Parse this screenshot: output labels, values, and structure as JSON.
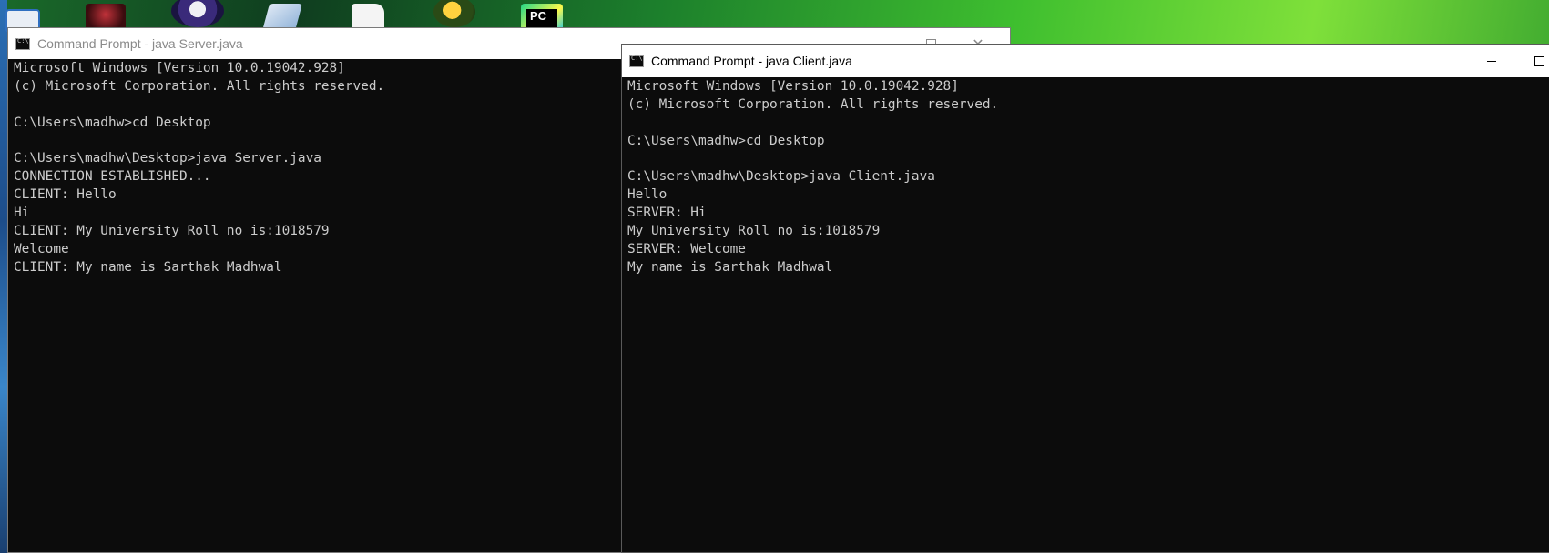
{
  "desktop": {
    "icons": [
      "windows-explorer-icon",
      "game-icon",
      "eclipse-icon",
      "notepad-icon",
      "file-icon",
      "app-icon",
      "pycharm-icon"
    ],
    "pycharm_label": "PC"
  },
  "server_window": {
    "title": "Command Prompt - java  Server.java",
    "lines": [
      "Microsoft Windows [Version 10.0.19042.928]",
      "(c) Microsoft Corporation. All rights reserved.",
      "",
      "C:\\Users\\madhw>cd Desktop",
      "",
      "C:\\Users\\madhw\\Desktop>java Server.java",
      "CONNECTION ESTABLISHED...",
      "CLIENT: Hello",
      "Hi",
      "CLIENT: My University Roll no is:1018579",
      "Welcome",
      "CLIENT: My name is Sarthak Madhwal"
    ]
  },
  "client_window": {
    "title": "Command Prompt - java  Client.java",
    "lines": [
      "Microsoft Windows [Version 10.0.19042.928]",
      "(c) Microsoft Corporation. All rights reserved.",
      "",
      "C:\\Users\\madhw>cd Desktop",
      "",
      "C:\\Users\\madhw\\Desktop>java Client.java",
      "Hello",
      "SERVER: Hi",
      "My University Roll no is:1018579",
      "SERVER: Welcome",
      "My name is Sarthak Madhwal"
    ]
  },
  "colors": {
    "console_bg": "#0c0c0c",
    "console_text": "#cccccc",
    "titlebar_bg": "#ffffff"
  }
}
